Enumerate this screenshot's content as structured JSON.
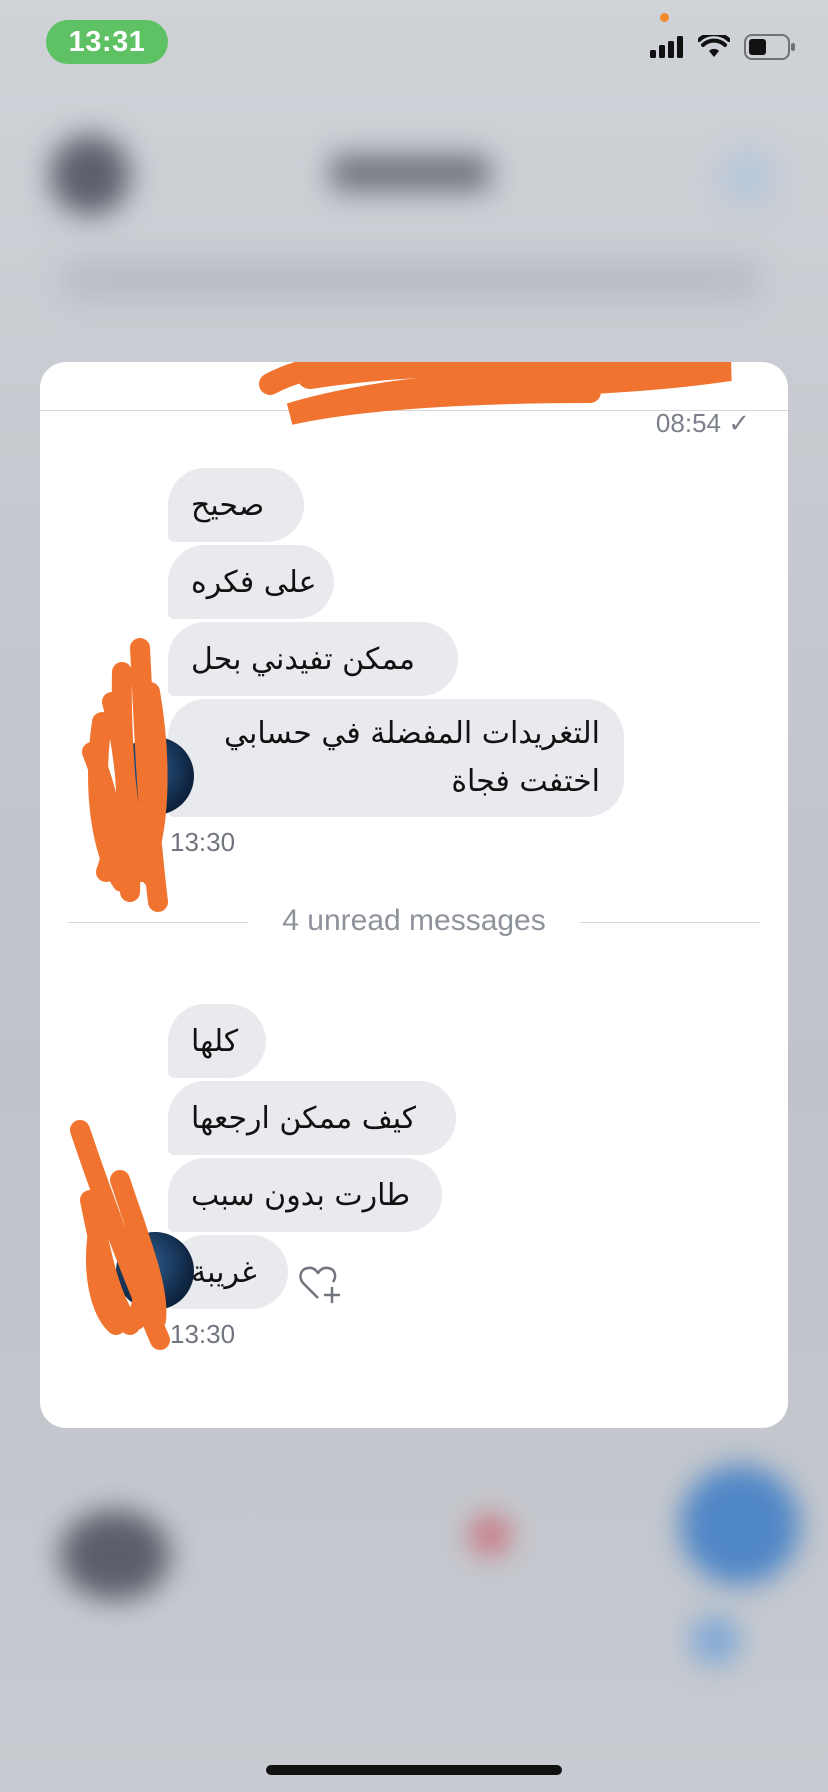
{
  "status_bar": {
    "time": "13:31"
  },
  "conversation": {
    "previous_time": "08:54 ✓",
    "first_group": {
      "messages": [
        "صحيح",
        "على فكره",
        "ممكن تفيدني بحل",
        "التغريدات المفضلة في حسابي اختفت فجاة"
      ],
      "time": "13:30"
    },
    "unread_divider": "4 unread messages",
    "second_group": {
      "messages": [
        "كلها",
        "كيف ممكن ارجعها",
        "طارت بدون سبب",
        "غريبة"
      ],
      "time": "13:30"
    }
  },
  "colors": {
    "bubble": "#e8eaee",
    "redaction": "#f07430",
    "time_pill": "#5ec265"
  }
}
